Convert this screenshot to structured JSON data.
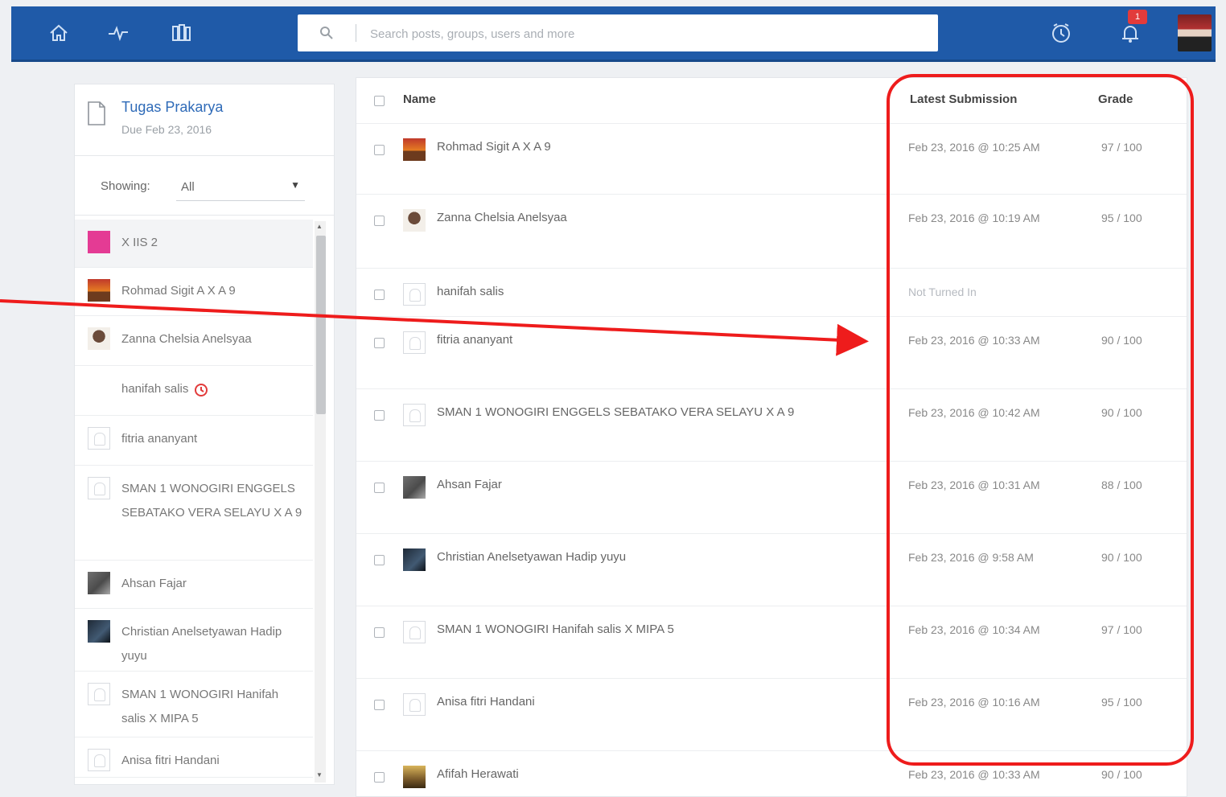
{
  "topbar": {
    "nav": [
      {
        "icon": "home-icon"
      },
      {
        "icon": "activity-icon"
      },
      {
        "icon": "library-icon"
      }
    ],
    "search_placeholder": "Search posts, groups, users and more",
    "right_icons": [
      "clock-icon",
      "bell-icon"
    ],
    "notification_count": "1",
    "brand_color": "#1f5aa8"
  },
  "sidebar": {
    "assignment_title": "Tugas Prakarya",
    "assignment_due": "Due Feb 23, 2016",
    "filter_label": "Showing:",
    "filter_value": "All",
    "students": [
      {
        "name": "X IIS 2",
        "avatar": "group"
      },
      {
        "name": "Rohmad Sigit A X A 9",
        "avatar": "photo1"
      },
      {
        "name": "Zanna Chelsia Anelsyaa",
        "avatar": "photo2"
      },
      {
        "name": "hanifah salis",
        "avatar": "none",
        "late": true
      },
      {
        "name": "fitria ananyant",
        "avatar": "blank"
      },
      {
        "name": "SMAN 1 WONOGIRI ENGGELS SEBATAKO VERA SELAYU X A 9",
        "avatar": "blank"
      },
      {
        "name": "Ahsan Fajar",
        "avatar": "photo3"
      },
      {
        "name": "Christian Anelsetyawan Hadip yuyu",
        "avatar": "photo4"
      },
      {
        "name": "SMAN 1 WONOGIRI Hanifah salis X MIPA 5",
        "avatar": "blank"
      },
      {
        "name": "Anisa fitri Handani",
        "avatar": "blank"
      }
    ]
  },
  "table": {
    "headers": {
      "name": "Name",
      "latest": "Latest Submission",
      "grade": "Grade"
    },
    "rows": [
      {
        "name": "Rohmad Sigit A X A 9",
        "date": "Feb 23, 2016 @ 10:25 AM",
        "grade": "97 / 100",
        "avatar": "photo1"
      },
      {
        "name": "Zanna Chelsia Anelsyaa",
        "date": "Feb 23, 2016 @ 10:19 AM",
        "grade": "95 / 100",
        "avatar": "photo2"
      },
      {
        "name": "hanifah salis",
        "date": "Not Turned In",
        "grade": "",
        "avatar": "blank",
        "not_turned_in": true
      },
      {
        "name": "fitria ananyant",
        "date": "Feb 23, 2016 @ 10:33 AM",
        "grade": "90 / 100",
        "avatar": "blank"
      },
      {
        "name": "SMAN 1 WONOGIRI ENGGELS SEBATAKO VERA SELAYU X A 9",
        "date": "Feb 23, 2016 @ 10:42 AM",
        "grade": "90 / 100",
        "avatar": "blank"
      },
      {
        "name": "Ahsan Fajar",
        "date": "Feb 23, 2016 @ 10:31 AM",
        "grade": "88 / 100",
        "avatar": "photo3"
      },
      {
        "name": "Christian Anelsetyawan Hadip yuyu",
        "date": "Feb 23, 2016 @ 9:58 AM",
        "grade": "90 / 100",
        "avatar": "photo4"
      },
      {
        "name": "SMAN 1 WONOGIRI Hanifah salis X MIPA 5",
        "date": "Feb 23, 2016 @ 10:34 AM",
        "grade": "97 / 100",
        "avatar": "blank"
      },
      {
        "name": "Anisa fitri Handani",
        "date": "Feb 23, 2016 @ 10:16 AM",
        "grade": "95 / 100",
        "avatar": "blank"
      },
      {
        "name": "Afifah Herawati",
        "date": "Feb 23, 2016 @ 10:33 AM",
        "grade": "90 / 100",
        "avatar": "photo5"
      }
    ]
  },
  "annotation": {
    "color": "#ee1c1c"
  }
}
